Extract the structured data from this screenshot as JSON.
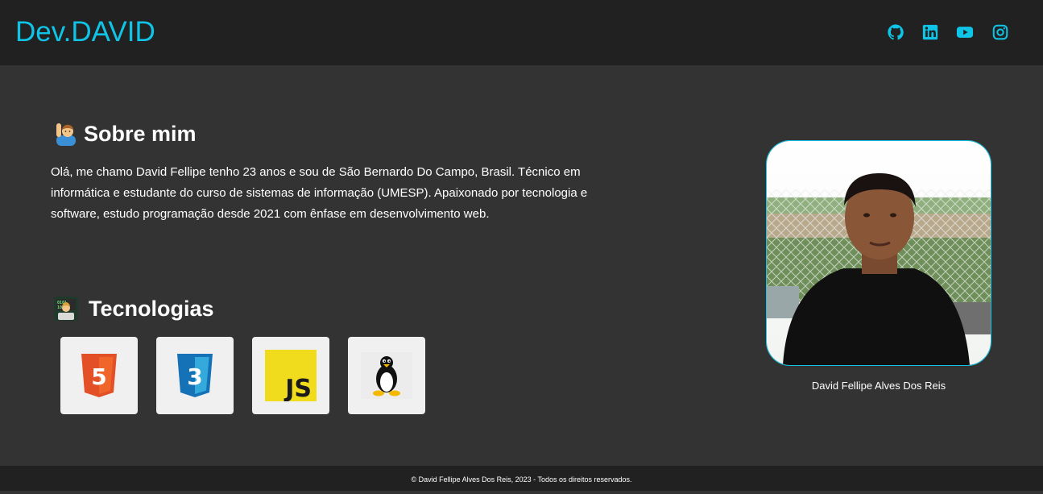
{
  "header": {
    "logo": "Dev.DAVID",
    "social": [
      {
        "icon": "github-icon"
      },
      {
        "icon": "linkedin-icon"
      },
      {
        "icon": "youtube-icon"
      },
      {
        "icon": "instagram-icon"
      }
    ]
  },
  "about": {
    "title": "Sobre mim",
    "text": "Olá, me chamo David Fellipe tenho 23 anos e sou de São Bernardo Do Campo, Brasil. Técnico em informática e estudante do curso de sistemas de informação (UMESP). Apaixonado por tecnologia e software, estudo programação desde 2021 com ênfase em desenvolvimento web."
  },
  "technologies": {
    "title": "Tecnologias",
    "items": [
      {
        "name": "html5-logo",
        "badge": "5"
      },
      {
        "name": "css3-logo",
        "badge": "3"
      },
      {
        "name": "javascript-logo",
        "badge": "JS"
      },
      {
        "name": "linux-logo"
      }
    ]
  },
  "profile": {
    "caption": "David Fellipe Alves Dos Reis"
  },
  "footer": {
    "text": "© David Fellipe Alves Dos Reis, 2023 - Todos os direitos reservados."
  },
  "colors": {
    "accent": "#0fc4e6",
    "header_bg": "#212121",
    "body_bg": "#333333"
  }
}
